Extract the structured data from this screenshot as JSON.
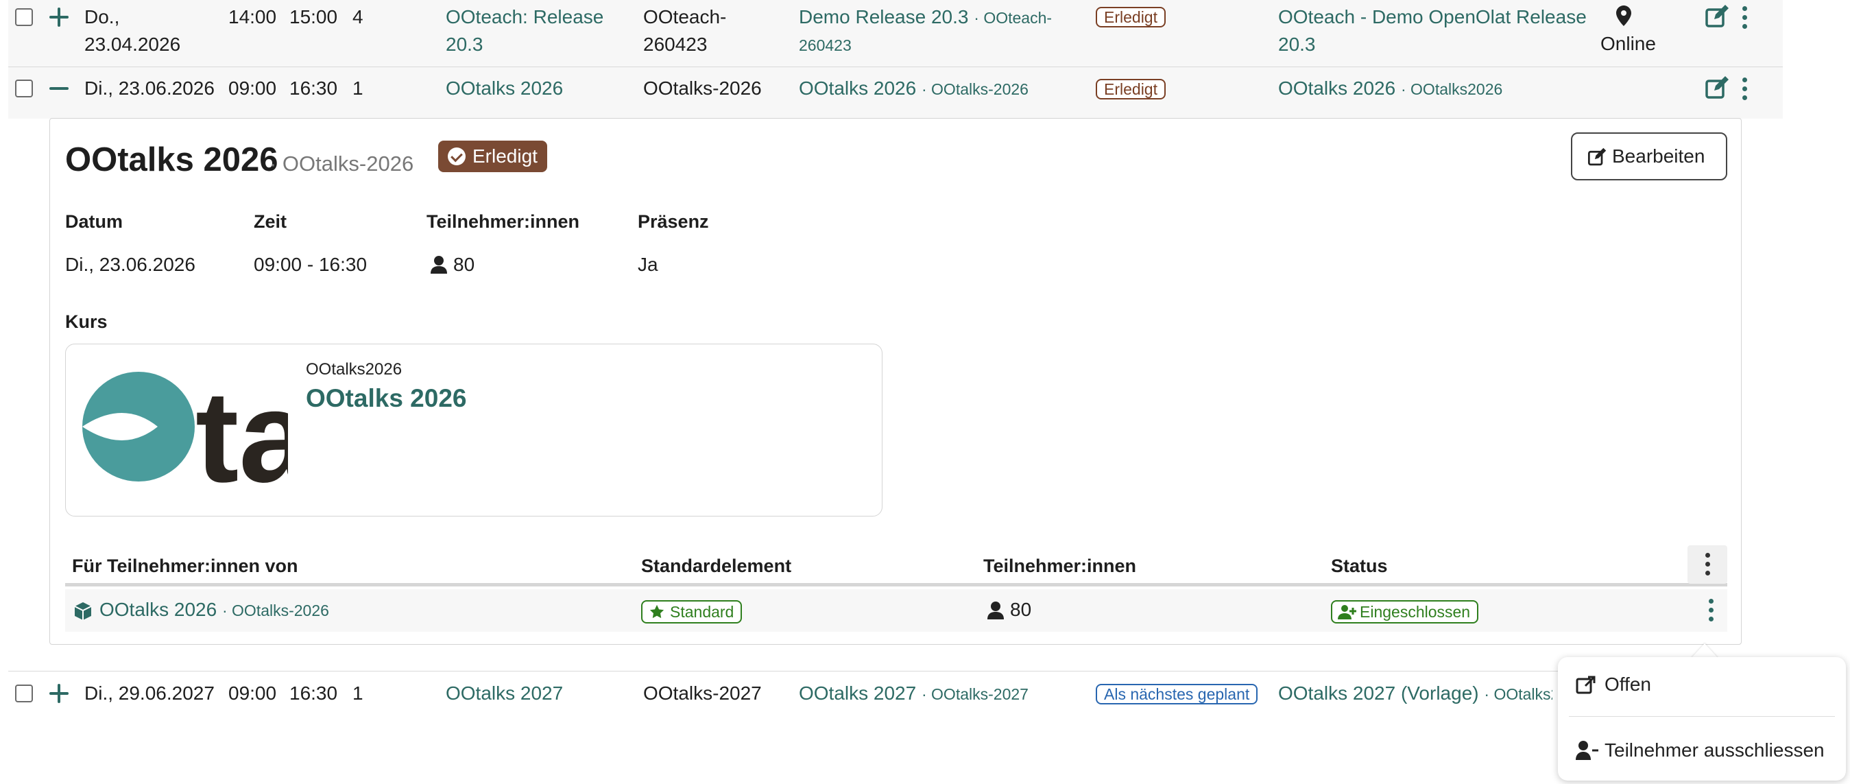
{
  "rows": [
    {
      "date_line1": "Do.,",
      "date_line2": "23.04.2026",
      "start": "14:00",
      "end": "15:00",
      "count": "4",
      "event_line1": "OOteach: Release",
      "event_line2": "20.3",
      "ext_line1": "OOteach-",
      "ext_line2": "260423",
      "impl_title": "Demo Release 20.3",
      "impl_ext_line1": "OOteach-",
      "impl_ext_line2": "260423",
      "status": "Erledigt",
      "course_line1": "OOteach - Demo OpenOlat Release",
      "course_line2": "20.3",
      "location": "Online"
    },
    {
      "date": "Di., 23.06.2026",
      "start": "09:00",
      "end": "16:30",
      "count": "1",
      "event": "OOtalks 2026",
      "ext": "OOtalks-2026",
      "impl_title": "OOtalks 2026",
      "impl_ext": "OOtalks-2026",
      "status": "Erledigt",
      "course": "OOtalks 2026",
      "course_ext": "OOtalks2026"
    },
    {
      "date": "Di., 29.06.2027",
      "start": "09:00",
      "end": "16:30",
      "count": "1",
      "event": "OOtalks 2027",
      "ext": "OOtalks-2027",
      "impl_title": "OOtalks 2027",
      "impl_ext": "OOtalks-2027",
      "status": "Als nächstes geplant",
      "course": "OOtalks 2027 (Vorlage)",
      "course_ext": "OOtalks2"
    }
  ],
  "detail": {
    "title": "OOtalks 2026",
    "subtitle": "· OOtalks-2026",
    "status": "Erledigt",
    "edit_label": "Bearbeiten",
    "labels": {
      "date": "Datum",
      "time": "Zeit",
      "participants": "Teilnehmer:innen",
      "presence": "Präsenz",
      "course": "Kurs"
    },
    "values": {
      "date": "Di., 23.06.2026",
      "time": "09:00 - 16:30",
      "participants": "80",
      "presence": "Ja"
    },
    "course_card": {
      "ext_ref": "OOtalks2026",
      "title": "OOtalks 2026",
      "logo_text": "ta"
    },
    "sub_table": {
      "headers": [
        "Für Teilnehmer:innen von",
        "Standardelement",
        "Teilnehmer:innen",
        "Status"
      ],
      "row": {
        "name": "OOtalks 2026",
        "ext": "· OOtalks-2026",
        "standard": "Standard",
        "participants": "80",
        "status": "Eingeschlossen"
      }
    }
  },
  "popup_menu": {
    "items": [
      "Offen",
      "Teilnehmer ausschliessen"
    ]
  },
  "colors": {
    "link": "#2d6a64",
    "done_badge": "#7a3f24",
    "planned_badge": "#2866b0",
    "included": "#2f7f1e",
    "status_pill_bg": "#7a4a33"
  }
}
